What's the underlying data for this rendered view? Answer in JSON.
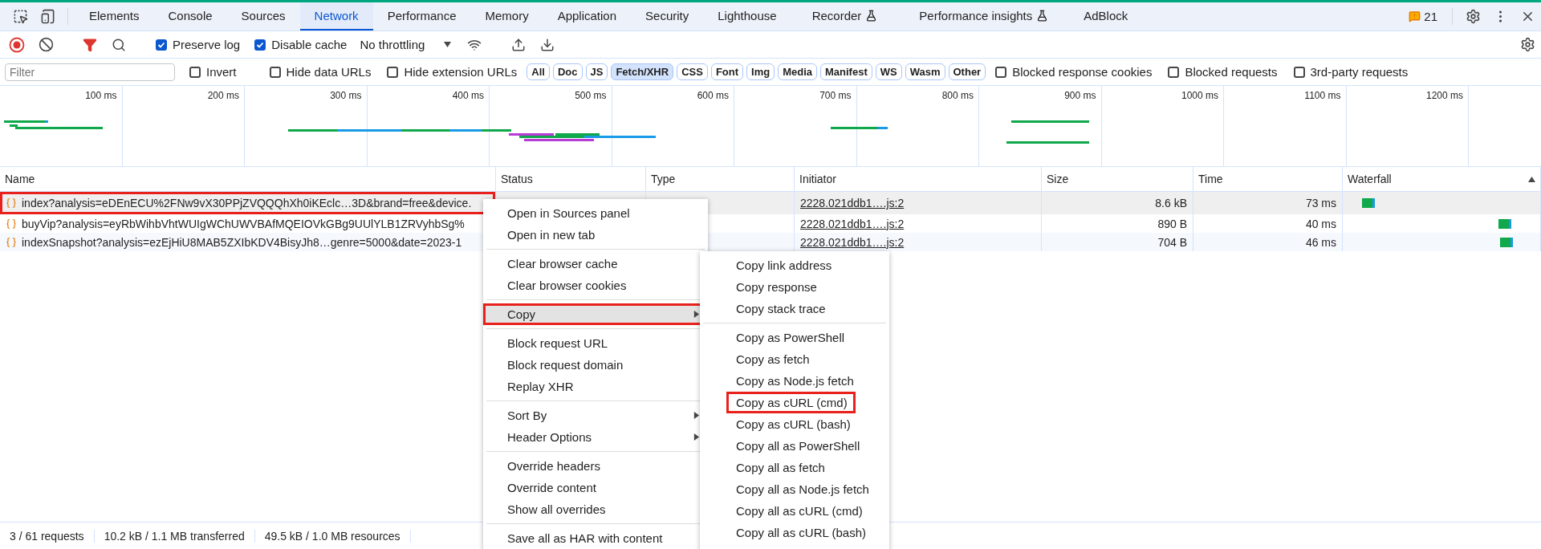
{
  "tabs": [
    {
      "label": "Elements",
      "selected": false,
      "experimental": false
    },
    {
      "label": "Console",
      "selected": false,
      "experimental": false
    },
    {
      "label": "Sources",
      "selected": false,
      "experimental": false
    },
    {
      "label": "Network",
      "selected": true,
      "experimental": false
    },
    {
      "label": "Performance",
      "selected": false,
      "experimental": false
    },
    {
      "label": "Memory",
      "selected": false,
      "experimental": false
    },
    {
      "label": "Application",
      "selected": false,
      "experimental": false
    },
    {
      "label": "Security",
      "selected": false,
      "experimental": false
    },
    {
      "label": "Lighthouse",
      "selected": false,
      "experimental": false
    },
    {
      "label": "Recorder",
      "selected": false,
      "experimental": true
    },
    {
      "label": "Performance insights",
      "selected": false,
      "experimental": true
    },
    {
      "label": "AdBlock",
      "selected": false,
      "experimental": false
    }
  ],
  "issues_count": "21",
  "toolbar": {
    "recording": true,
    "filter_active": true,
    "checkboxes": [
      {
        "label": "Preserve log",
        "checked": true
      },
      {
        "label": "Disable cache",
        "checked": true
      }
    ],
    "throttling": "No throttling"
  },
  "filter_bar": {
    "placeholder": "Filter",
    "invert": {
      "label": "Invert",
      "checked": false
    },
    "options": [
      {
        "label": "Hide data URLs",
        "checked": false
      },
      {
        "label": "Hide extension URLs",
        "checked": false
      }
    ],
    "types": [
      {
        "label": "All",
        "selected": false
      },
      {
        "label": "Doc",
        "selected": false
      },
      {
        "label": "JS",
        "selected": false
      },
      {
        "label": "Fetch/XHR",
        "selected": true
      },
      {
        "label": "CSS",
        "selected": false
      },
      {
        "label": "Font",
        "selected": false
      },
      {
        "label": "Img",
        "selected": false
      },
      {
        "label": "Media",
        "selected": false
      },
      {
        "label": "Manifest",
        "selected": false
      },
      {
        "label": "WS",
        "selected": false
      },
      {
        "label": "Wasm",
        "selected": false
      },
      {
        "label": "Other",
        "selected": false
      }
    ],
    "extra_options": [
      {
        "label": "Blocked response cookies",
        "checked": false
      },
      {
        "label": "Blocked requests",
        "checked": false
      },
      {
        "label": "3rd-party requests",
        "checked": false
      }
    ]
  },
  "overview": {
    "ticks": [
      "100 ms",
      "200 ms",
      "300 ms",
      "400 ms",
      "500 ms",
      "600 ms",
      "700 ms",
      "800 ms",
      "900 ms",
      "1000 ms",
      "1100 ms",
      "1200 ms"
    ]
  },
  "table": {
    "columns": [
      {
        "label": "Name",
        "sorted": false
      },
      {
        "label": "Status",
        "sorted": false
      },
      {
        "label": "Type",
        "sorted": false
      },
      {
        "label": "Initiator",
        "sorted": false
      },
      {
        "label": "Size",
        "sorted": false
      },
      {
        "label": "Time",
        "sorted": false
      },
      {
        "label": "Waterfall",
        "sorted": true
      }
    ],
    "rows": [
      {
        "name": "index?analysis=eDEnECU%2FNw9vX30PPjZVQQQhXh0iKEclc…3D&brand=free&device.",
        "initiator": "2228.021ddb1….js:2",
        "size": "8.6 kB",
        "time": "73 ms",
        "selected": true,
        "annotated": true
      },
      {
        "name": "buyVip?analysis=eyRbWihbVhtWUIgWChUWVBAfMQEIOVkGBg9UUlYLB1ZRVyhbSg%",
        "initiator": "2228.021ddb1….js:2",
        "size": "890 B",
        "time": "40 ms",
        "selected": false,
        "annotated": false
      },
      {
        "name": "indexSnapshot?analysis=ezEjHiU8MAB5ZXIbKDV4BisyJh8…genre=5000&date=2023-1",
        "initiator": "2228.021ddb1….js:2",
        "size": "704 B",
        "time": "46 ms",
        "selected": false,
        "annotated": false
      }
    ]
  },
  "status_bar": [
    "3 / 61 requests",
    "10.2 kB / 1.1 MB transferred",
    "49.5 kB / 1.0 MB resources"
  ],
  "context_menu": {
    "groups": [
      [
        {
          "label": "Open in Sources panel",
          "submenu": false,
          "selected": false,
          "annotated": false
        },
        {
          "label": "Open in new tab",
          "submenu": false,
          "selected": false,
          "annotated": false
        }
      ],
      [
        {
          "label": "Clear browser cache",
          "submenu": false,
          "selected": false,
          "annotated": false
        },
        {
          "label": "Clear browser cookies",
          "submenu": false,
          "selected": false,
          "annotated": false
        }
      ],
      [
        {
          "label": "Copy",
          "submenu": true,
          "selected": true,
          "annotated": true
        }
      ],
      [
        {
          "label": "Block request URL",
          "submenu": false,
          "selected": false,
          "annotated": false
        },
        {
          "label": "Block request domain",
          "submenu": false,
          "selected": false,
          "annotated": false
        },
        {
          "label": "Replay XHR",
          "submenu": false,
          "selected": false,
          "annotated": false
        }
      ],
      [
        {
          "label": "Sort By",
          "submenu": true,
          "selected": false,
          "annotated": false
        },
        {
          "label": "Header Options",
          "submenu": true,
          "selected": false,
          "annotated": false
        }
      ],
      [
        {
          "label": "Override headers",
          "submenu": false,
          "selected": false,
          "annotated": false
        },
        {
          "label": "Override content",
          "submenu": false,
          "selected": false,
          "annotated": false
        },
        {
          "label": "Show all overrides",
          "submenu": false,
          "selected": false,
          "annotated": false
        }
      ],
      [
        {
          "label": "Save all as HAR with content",
          "submenu": false,
          "selected": false,
          "annotated": false
        }
      ]
    ]
  },
  "submenu": {
    "groups": [
      [
        {
          "label": "Copy link address",
          "annotated": false
        },
        {
          "label": "Copy response",
          "annotated": false
        },
        {
          "label": "Copy stack trace",
          "annotated": false
        }
      ],
      [
        {
          "label": "Copy as PowerShell",
          "annotated": false
        },
        {
          "label": "Copy as fetch",
          "annotated": false
        },
        {
          "label": "Copy as Node.js fetch",
          "annotated": false
        },
        {
          "label": "Copy as cURL (cmd)",
          "annotated": true
        },
        {
          "label": "Copy as cURL (bash)",
          "annotated": false
        },
        {
          "label": "Copy all as PowerShell",
          "annotated": false
        },
        {
          "label": "Copy all as fetch",
          "annotated": false
        },
        {
          "label": "Copy all as Node.js fetch",
          "annotated": false
        },
        {
          "label": "Copy all as cURL (cmd)",
          "annotated": false
        },
        {
          "label": "Copy all as cURL (bash)",
          "annotated": false
        }
      ]
    ]
  }
}
